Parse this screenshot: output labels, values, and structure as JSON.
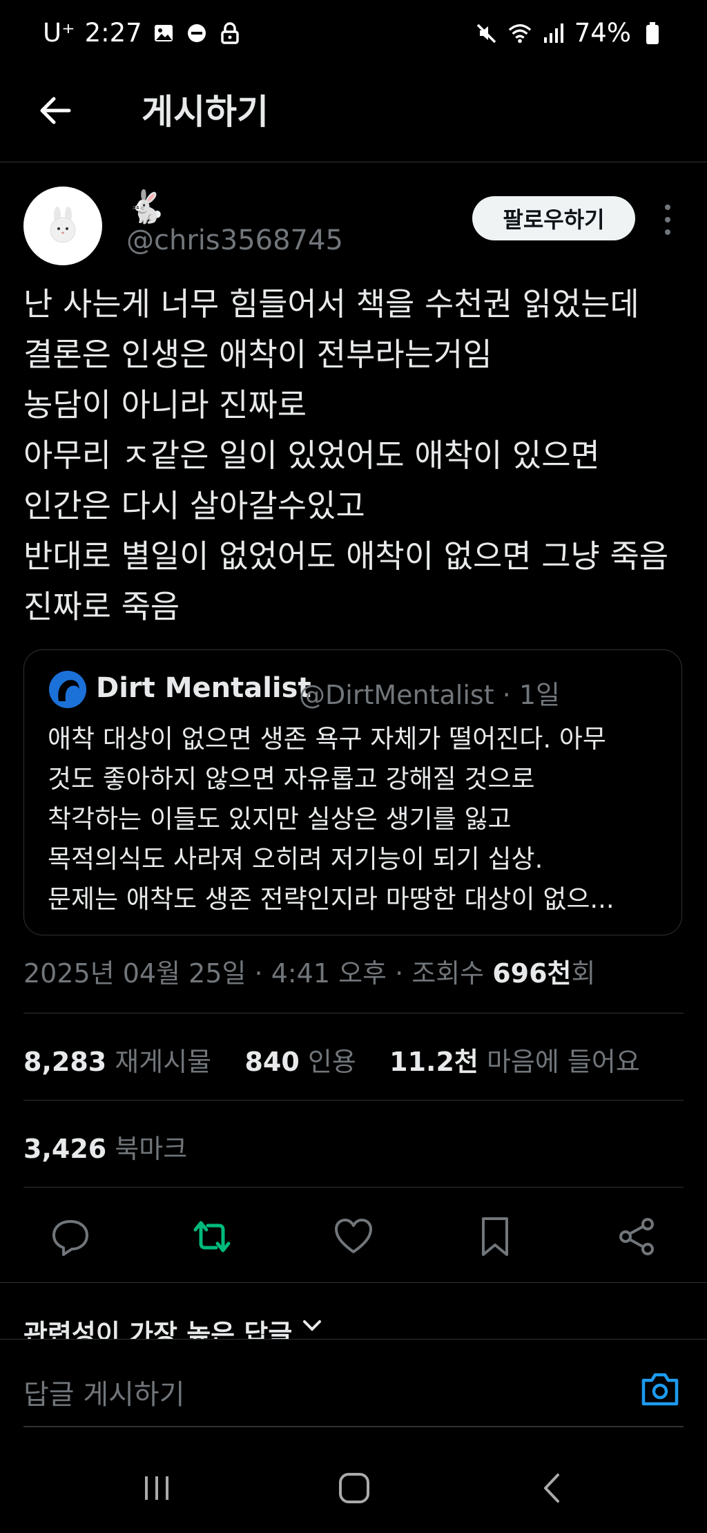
{
  "status_bar": {
    "carrier": "U⁺",
    "time": "2:27",
    "battery": "74%"
  },
  "header": {
    "title": "게시하기"
  },
  "post": {
    "display_name_emoji": "🐇",
    "handle": "@chris3568745",
    "follow_label": "팔로우하기",
    "lines": [
      "난 사는게 너무 힘들어서 책을 수천권 읽었는데",
      "결론은 인생은 애착이 전부라는거임",
      "농담이 아니라 진짜로",
      "아무리 ㅈ같은 일이 있었어도 애착이 있으면",
      "인간은 다시 살아갈수있고",
      "반대로 별일이 없었어도 애착이 없으면 그냥 죽음",
      "진짜로 죽음"
    ]
  },
  "quote": {
    "name": "Dirt Mentalist",
    "handle_time": "@DirtMentalist · 1일",
    "lines": [
      "애착 대상이 없으면 생존 욕구 자체가 떨어진다. 아무",
      "것도 좋아하지 않으면 자유롭고 강해질 것으로",
      "착각하는 이들도 있지만 실상은 생기를 잃고",
      "목적의식도 사라져 오히려 저기능이 되기 십상.",
      "문제는 애착도 생존 전략인지라 마땅한 대상이 없으..."
    ]
  },
  "meta": {
    "datetime": "2025년 04월 25일 · 4:41 오후 · 조회수 ",
    "views": "696천",
    "views_suffix": "회"
  },
  "stats": {
    "reposts_count": "8,283",
    "reposts_label": "재게시물",
    "quotes_count": "840",
    "quotes_label": "인용",
    "likes_count": "11.2천",
    "likes_label": "마음에 들어요",
    "bookmarks_count": "3,426",
    "bookmarks_label": "북마크"
  },
  "replies": {
    "sort_label": "관련성이 가장 높은 답글",
    "input_placeholder": "답글 게시하기"
  },
  "colors": {
    "background": "#000000",
    "text": "#e7e9ea",
    "muted": "#71767b",
    "repost_active": "#00ba7c",
    "accent": "#1d9bf0"
  }
}
